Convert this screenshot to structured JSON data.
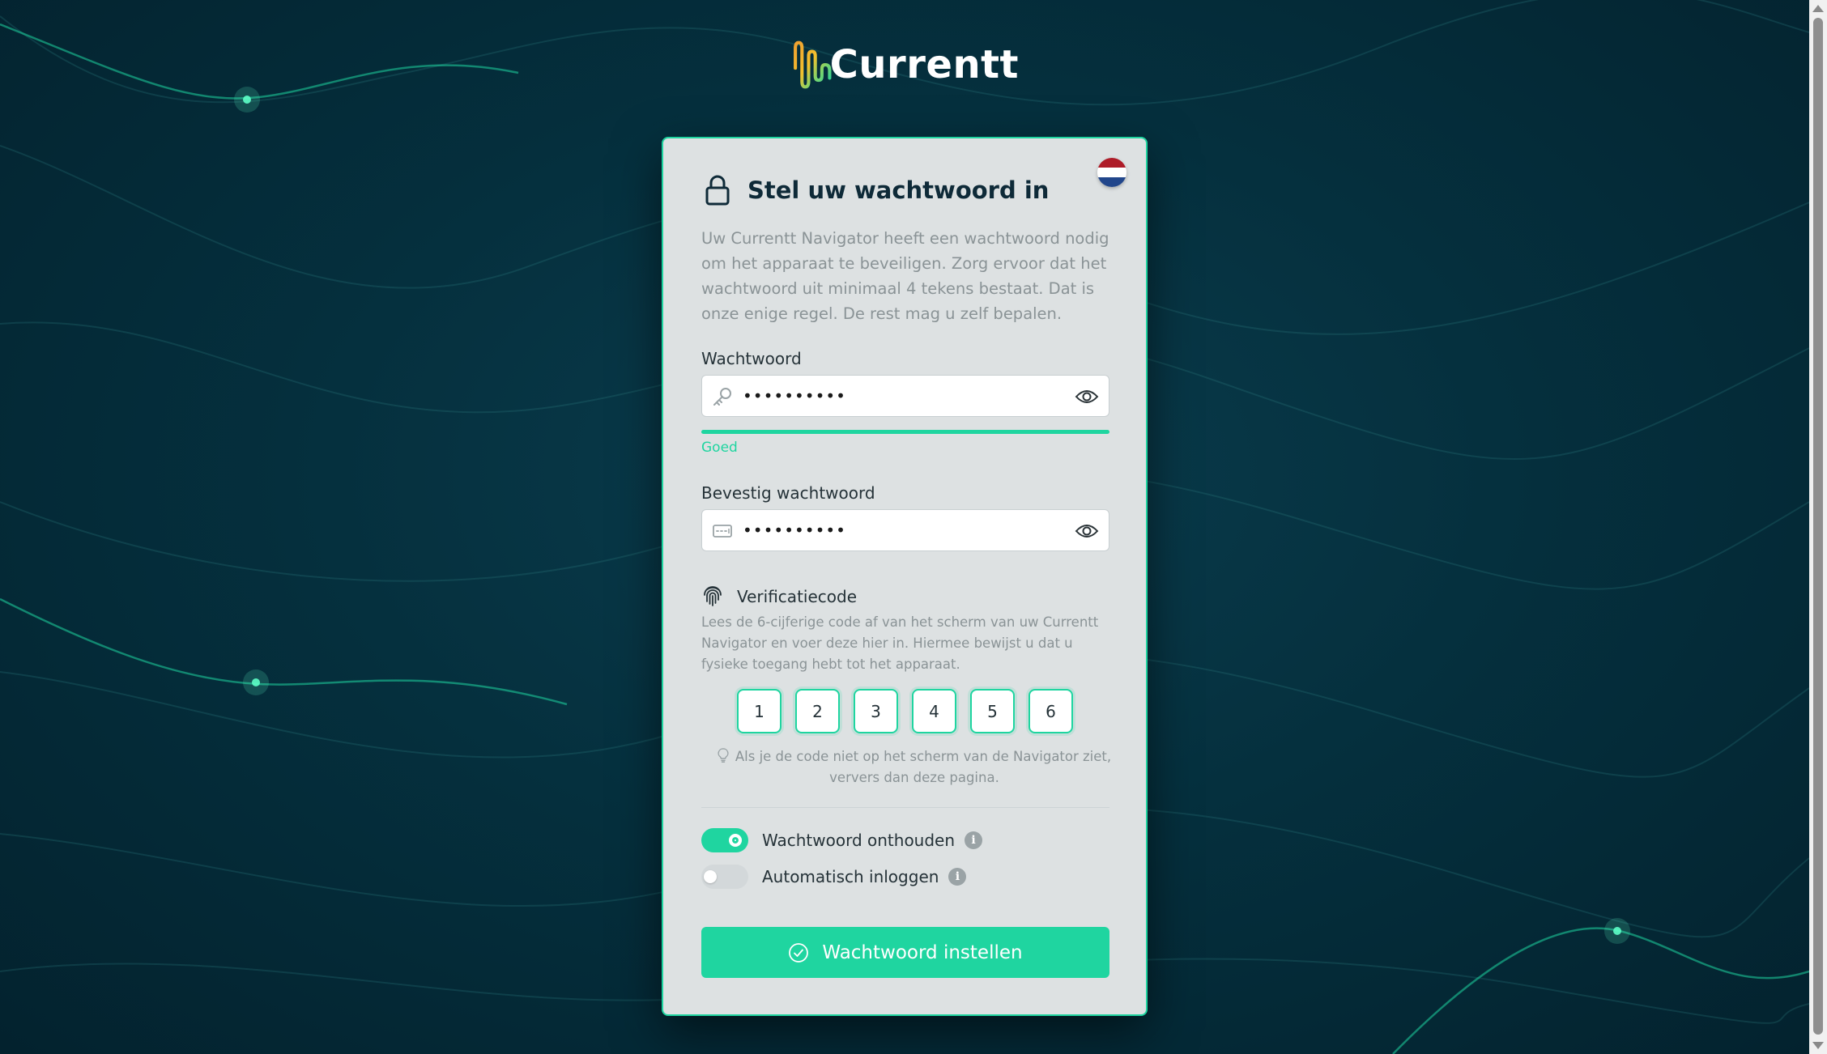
{
  "brand": {
    "name": "Currentt"
  },
  "card": {
    "title": "Stel uw wachtwoord in",
    "intro": "Uw Currentt Navigator heeft een wachtwoord nodig om het apparaat te beveiligen. Zorg ervoor dat het wachtwoord uit minimaal 4 tekens bestaat. Dat is onze enige regel. De rest mag u zelf bepalen.",
    "language_flag": "nl-flag-icon"
  },
  "password": {
    "label": "Wachtwoord",
    "value": "••••••••••",
    "strength_label": "Goed",
    "strength": 1.0
  },
  "confirm": {
    "label": "Bevestig wachtwoord",
    "value": "••••••••••"
  },
  "verification": {
    "title": "Verificatiecode",
    "description": "Lees de 6-cijferige code af van het scherm van uw Currentt Navigator en voer deze hier in. Hiermee bewijst u dat u fysieke toegang hebt tot het apparaat.",
    "digits": [
      "1",
      "2",
      "3",
      "4",
      "5",
      "6"
    ],
    "hint": "Als je de code niet op het scherm van de Navigator ziet, ververs dan deze pagina."
  },
  "options": {
    "remember": {
      "label": "Wachtwoord onthouden",
      "on": true
    },
    "autologin": {
      "label": "Automatisch inloggen",
      "on": false
    }
  },
  "submit": {
    "label": "Wachtwoord instellen"
  },
  "colors": {
    "accent": "#1fd5a0",
    "background": "#05303e",
    "card": "#dde1e2",
    "title": "#0e2a38"
  }
}
